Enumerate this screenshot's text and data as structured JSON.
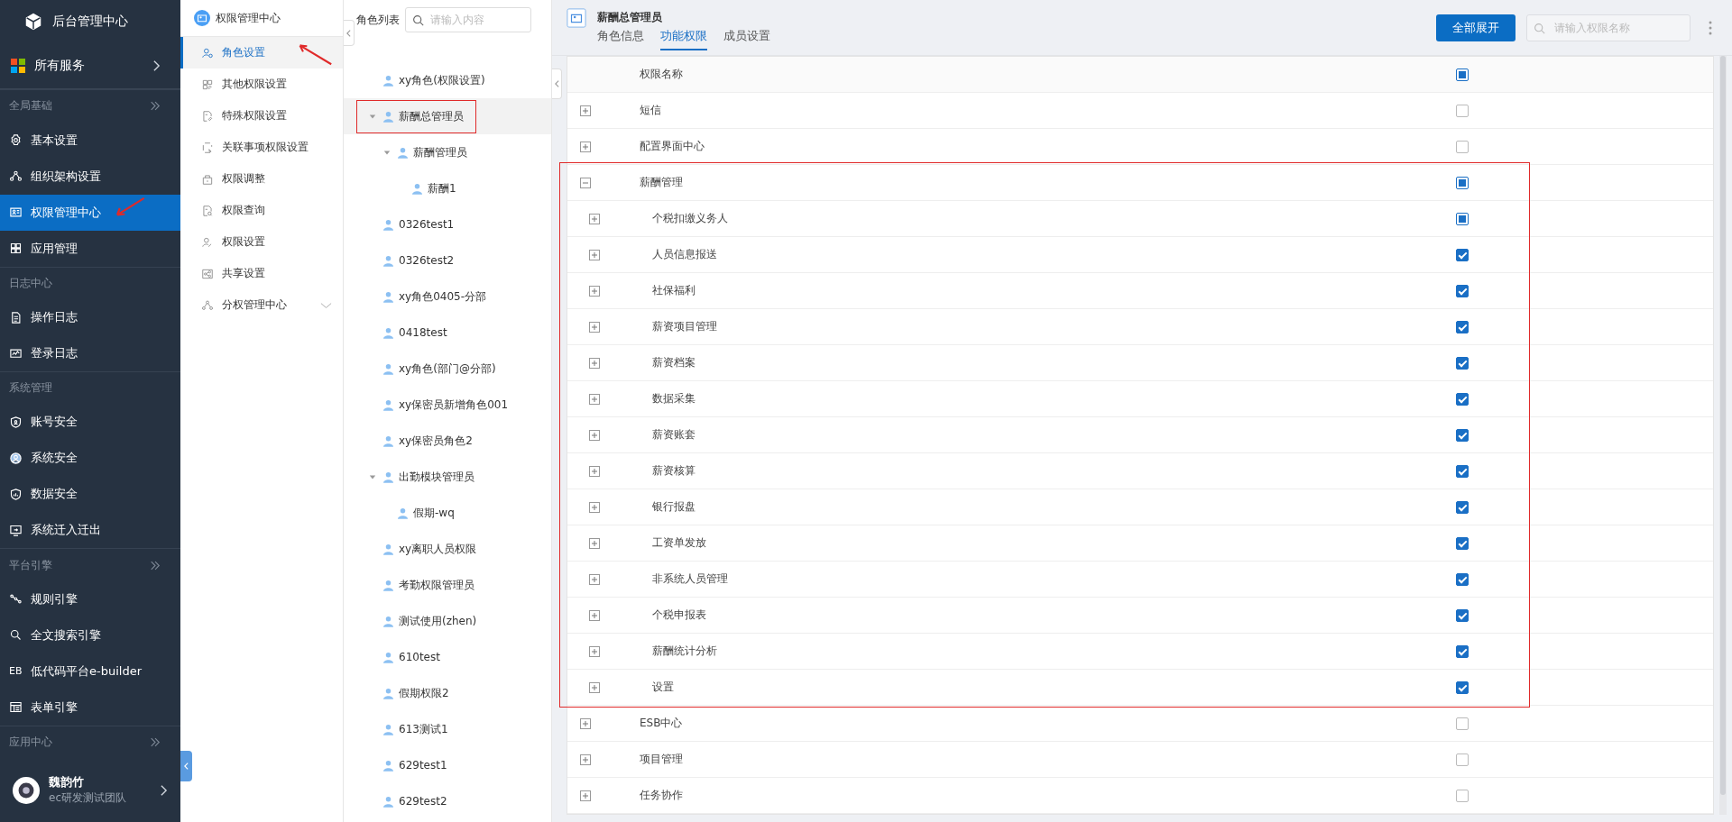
{
  "sidebar": {
    "brand": "后台管理中心",
    "all_services": "所有服务",
    "sections": [
      {
        "title": "全局基础",
        "more": true,
        "items": [
          {
            "label": "基本设置",
            "selected": false
          },
          {
            "label": "组织架构设置",
            "selected": false
          },
          {
            "label": "权限管理中心",
            "selected": true,
            "arrow": true
          },
          {
            "label": "应用管理",
            "selected": false
          }
        ]
      },
      {
        "title": "日志中心",
        "more": false,
        "items": [
          {
            "label": "操作日志",
            "selected": false
          },
          {
            "label": "登录日志",
            "selected": false
          }
        ]
      },
      {
        "title": "系统管理",
        "more": false,
        "items": [
          {
            "label": "账号安全",
            "selected": false
          },
          {
            "label": "系统安全",
            "selected": false
          },
          {
            "label": "数据安全",
            "selected": false
          },
          {
            "label": "系统迁入迁出",
            "selected": false
          }
        ]
      },
      {
        "title": "平台引擎",
        "more": true,
        "items": [
          {
            "label": "规则引擎",
            "selected": false
          },
          {
            "label": "全文搜索引擎",
            "selected": false
          },
          {
            "label": "低代码平台e-builder",
            "selected": false,
            "icon_text": "EB"
          },
          {
            "label": "表单引擎",
            "selected": false
          }
        ]
      },
      {
        "title": "应用中心",
        "more": true
      }
    ],
    "user": {
      "name": "魏韵竹",
      "team": "ec研发测试团队"
    }
  },
  "submenu": {
    "title": "权限管理中心",
    "items": [
      {
        "label": "角色设置",
        "selected": true,
        "arrow": true
      },
      {
        "label": "其他权限设置",
        "selected": false
      },
      {
        "label": "特殊权限设置",
        "selected": false
      },
      {
        "label": "关联事项权限设置",
        "selected": false
      },
      {
        "label": "权限调整",
        "selected": false
      },
      {
        "label": "权限查询",
        "selected": false
      },
      {
        "label": "权限设置",
        "selected": false
      },
      {
        "label": "共享设置",
        "selected": false
      },
      {
        "label": "分权管理中心",
        "selected": false,
        "expanded": false
      }
    ]
  },
  "roles": {
    "title": "角色列表",
    "search_placeholder": "请输入内容",
    "items": [
      {
        "name": "xy角色(权限设置)",
        "selected": false
      },
      {
        "name": "薪酬总管理员",
        "selected": true,
        "highlighted": true,
        "expanded": true,
        "children": [
          {
            "name": "薪酬管理员",
            "selected": false,
            "expanded": true,
            "children": [
              {
                "name": "薪酬1",
                "selected": false
              }
            ]
          }
        ]
      },
      {
        "name": "0326test1",
        "selected": false
      },
      {
        "name": "0326test2",
        "selected": false
      },
      {
        "name": "xy角色0405-分部",
        "selected": false
      },
      {
        "name": "0418test",
        "selected": false
      },
      {
        "name": "xy角色(部门@分部)",
        "selected": false
      },
      {
        "name": "xy保密员新增角色001",
        "selected": false
      },
      {
        "name": "xy保密员角色2",
        "selected": false
      },
      {
        "name": "出勤模块管理员",
        "selected": false,
        "expanded": true,
        "children": [
          {
            "name": "假期-wq",
            "selected": false
          }
        ]
      },
      {
        "name": "xy离职人员权限",
        "selected": false
      },
      {
        "name": "考勤权限管理员",
        "selected": false
      },
      {
        "name": "测试使用(zhen)",
        "selected": false
      },
      {
        "name": "610test",
        "selected": false
      },
      {
        "name": "假期权限2",
        "selected": false
      },
      {
        "name": "613测试1",
        "selected": false
      },
      {
        "name": "629test1",
        "selected": false
      },
      {
        "name": "629test2",
        "selected": false
      }
    ]
  },
  "main": {
    "title": "薪酬总管理员",
    "tabs": [
      {
        "label": "角色信息",
        "selected": false
      },
      {
        "label": "功能权限",
        "selected": true
      },
      {
        "label": "成员设置",
        "selected": false
      }
    ],
    "expand_all": "全部展开",
    "search_placeholder": "请输入权限名称",
    "table": {
      "column": "权限名称",
      "header_checked": false,
      "header_indeterminate": true,
      "rows": [
        {
          "name": "短信",
          "expanded": false,
          "checked": false
        },
        {
          "name": "配置界面中心",
          "expanded": false,
          "checked": false
        },
        {
          "name": "薪酬管理",
          "expanded": true,
          "checked": false,
          "indeterminate": true,
          "highlighted": true,
          "children": [
            {
              "name": "个税扣缴义务人",
              "expanded": false,
              "checked": false,
              "indeterminate": true
            },
            {
              "name": "人员信息报送",
              "expanded": false,
              "checked": true
            },
            {
              "name": "社保福利",
              "expanded": false,
              "checked": true
            },
            {
              "name": "薪资项目管理",
              "expanded": false,
              "checked": true
            },
            {
              "name": "薪资档案",
              "expanded": false,
              "checked": true
            },
            {
              "name": "数据采集",
              "expanded": false,
              "checked": true
            },
            {
              "name": "薪资账套",
              "expanded": false,
              "checked": true
            },
            {
              "name": "薪资核算",
              "expanded": false,
              "checked": true
            },
            {
              "name": "银行报盘",
              "expanded": false,
              "checked": true
            },
            {
              "name": "工资单发放",
              "expanded": false,
              "checked": true
            },
            {
              "name": "非系统人员管理",
              "expanded": false,
              "checked": true
            },
            {
              "name": "个税申报表",
              "expanded": false,
              "checked": true
            },
            {
              "name": "薪酬统计分析",
              "expanded": false,
              "checked": true
            },
            {
              "name": "设置",
              "expanded": false,
              "checked": true
            }
          ]
        },
        {
          "name": "ESB中心",
          "expanded": false,
          "checked": false
        },
        {
          "name": "项目管理",
          "expanded": false,
          "checked": false
        },
        {
          "name": "任务协作",
          "expanded": false,
          "checked": false
        }
      ]
    }
  }
}
